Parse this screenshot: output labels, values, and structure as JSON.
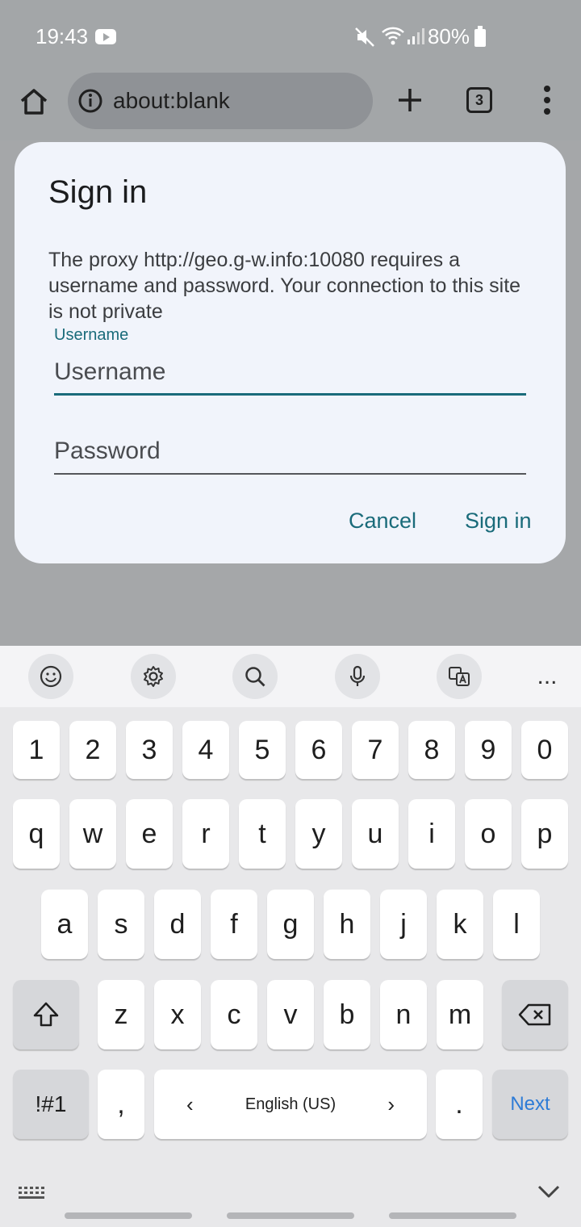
{
  "status_bar": {
    "time": "19:43",
    "battery": "80%"
  },
  "browser": {
    "url": "about:blank",
    "tab_count": "3"
  },
  "dialog": {
    "title": "Sign in",
    "message": "The proxy http://geo.g-w.info:10080 requires a username and password. Your connection to this site is not private",
    "username_label": "Username",
    "username_placeholder": "Username",
    "password_placeholder": "Password",
    "cancel_label": "Cancel",
    "signin_label": "Sign in"
  },
  "keyboard": {
    "number_row": [
      "1",
      "2",
      "3",
      "4",
      "5",
      "6",
      "7",
      "8",
      "9",
      "0"
    ],
    "row1": [
      "q",
      "w",
      "e",
      "r",
      "t",
      "y",
      "u",
      "i",
      "o",
      "p"
    ],
    "row2": [
      "a",
      "s",
      "d",
      "f",
      "g",
      "h",
      "j",
      "k",
      "l"
    ],
    "row3": [
      "z",
      "x",
      "c",
      "v",
      "b",
      "n",
      "m"
    ],
    "symbols_label": "!#1",
    "comma": ",",
    "period": ".",
    "space_label": "English (US)",
    "next_label": "Next",
    "more_label": "...",
    "toolbar_icons": [
      "emoji-icon",
      "settings-icon",
      "search-icon",
      "microphone-icon",
      "translate-icon"
    ]
  },
  "colors": {
    "accent": "#1a6b7a",
    "next": "#2d7bd6",
    "dialog_bg": "#f1f4fb"
  }
}
